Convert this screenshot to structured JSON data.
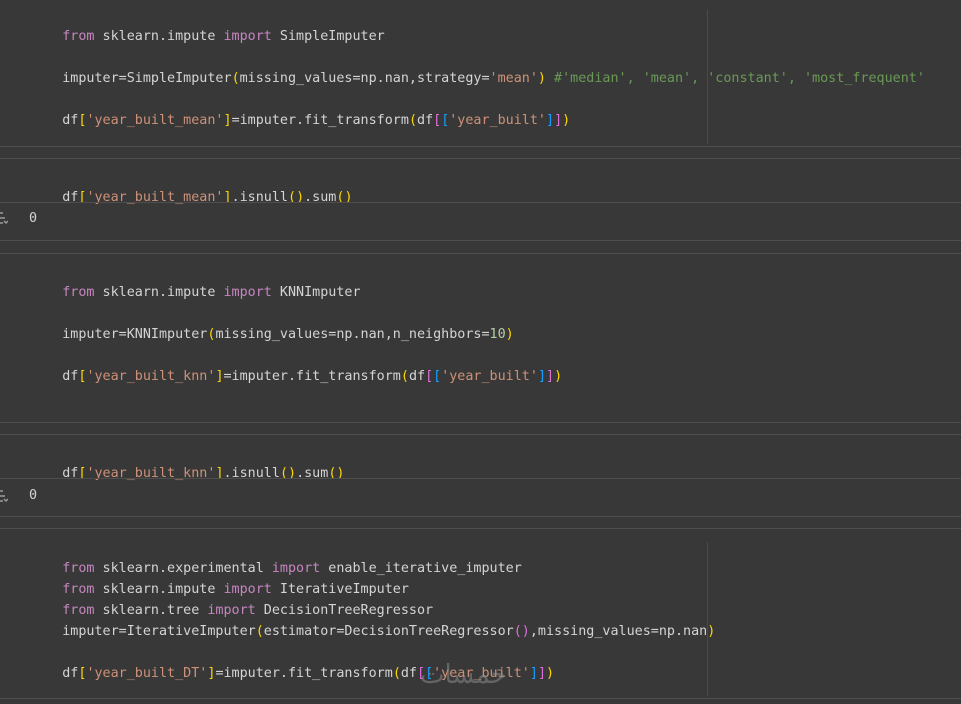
{
  "cells": [
    {
      "lines": [
        [
          "from",
          " sklearn.impute ",
          "import",
          " SimpleImputer"
        ],
        [
          "imputer=SimpleImputer",
          "(",
          "missing_values=np.nan,strategy=",
          "'mean'",
          ")",
          " ",
          "#'median', 'mean', 'constant', 'most_frequent'"
        ],
        [
          "df",
          "[",
          "'year_built_mean'",
          "]",
          "=imputer.fit_transform",
          "(",
          "df",
          "[",
          "[",
          "'year_built'",
          "]",
          "]",
          ")"
        ]
      ]
    },
    {
      "lines": [
        [
          "df",
          "[",
          "'year_built_mean'",
          "]",
          ".isnull",
          "(",
          ")",
          ".sum",
          "(",
          ")"
        ]
      ],
      "output": "0"
    },
    {
      "lines": [
        [
          "from",
          " sklearn.impute ",
          "import",
          " KNNImputer"
        ],
        [
          "imputer=KNNImputer",
          "(",
          "missing_values=np.nan,n_neighbors=",
          "10",
          ")"
        ],
        [
          "df",
          "[",
          "'year_built_knn'",
          "]",
          "=imputer.fit_transform",
          "(",
          "df",
          "[",
          "[",
          "'year_built'",
          "]",
          "]",
          ")"
        ]
      ]
    },
    {
      "lines": [
        [
          "df",
          "[",
          "'year_built_knn'",
          "]",
          ".isnull",
          "(",
          ")",
          ".sum",
          "(",
          ")"
        ]
      ],
      "output": "0"
    },
    {
      "lines": [
        [
          "from",
          " sklearn.experimental ",
          "import",
          " enable_iterative_imputer"
        ],
        [
          "from",
          " sklearn.impute ",
          "import",
          " IterativeImputer"
        ],
        [
          "from",
          " sklearn.tree ",
          "import",
          " DecisionTreeRegressor"
        ],
        [
          "imputer=IterativeImputer",
          "(",
          "estimator=DecisionTreeRegressor",
          "(",
          ")",
          ",missing_values=np.nan",
          ")"
        ],
        [
          "df",
          "[",
          "'year_built_DT'",
          "]",
          "=imputer.fit_transform",
          "(",
          "df",
          "[",
          "[",
          "'year_built'",
          "]",
          "]",
          ")"
        ]
      ]
    }
  ],
  "watermark": "خمسات",
  "colors": {
    "background": "#383838",
    "keyword": "#c586c0",
    "string": "#ce9178",
    "comment": "#6a9955",
    "number": "#b5cea8",
    "bracket_level1": "#ffd700",
    "bracket_level2": "#da70d6",
    "bracket_level3": "#179fff"
  },
  "icons": {
    "output_toggle": "output-toggle-icon"
  }
}
